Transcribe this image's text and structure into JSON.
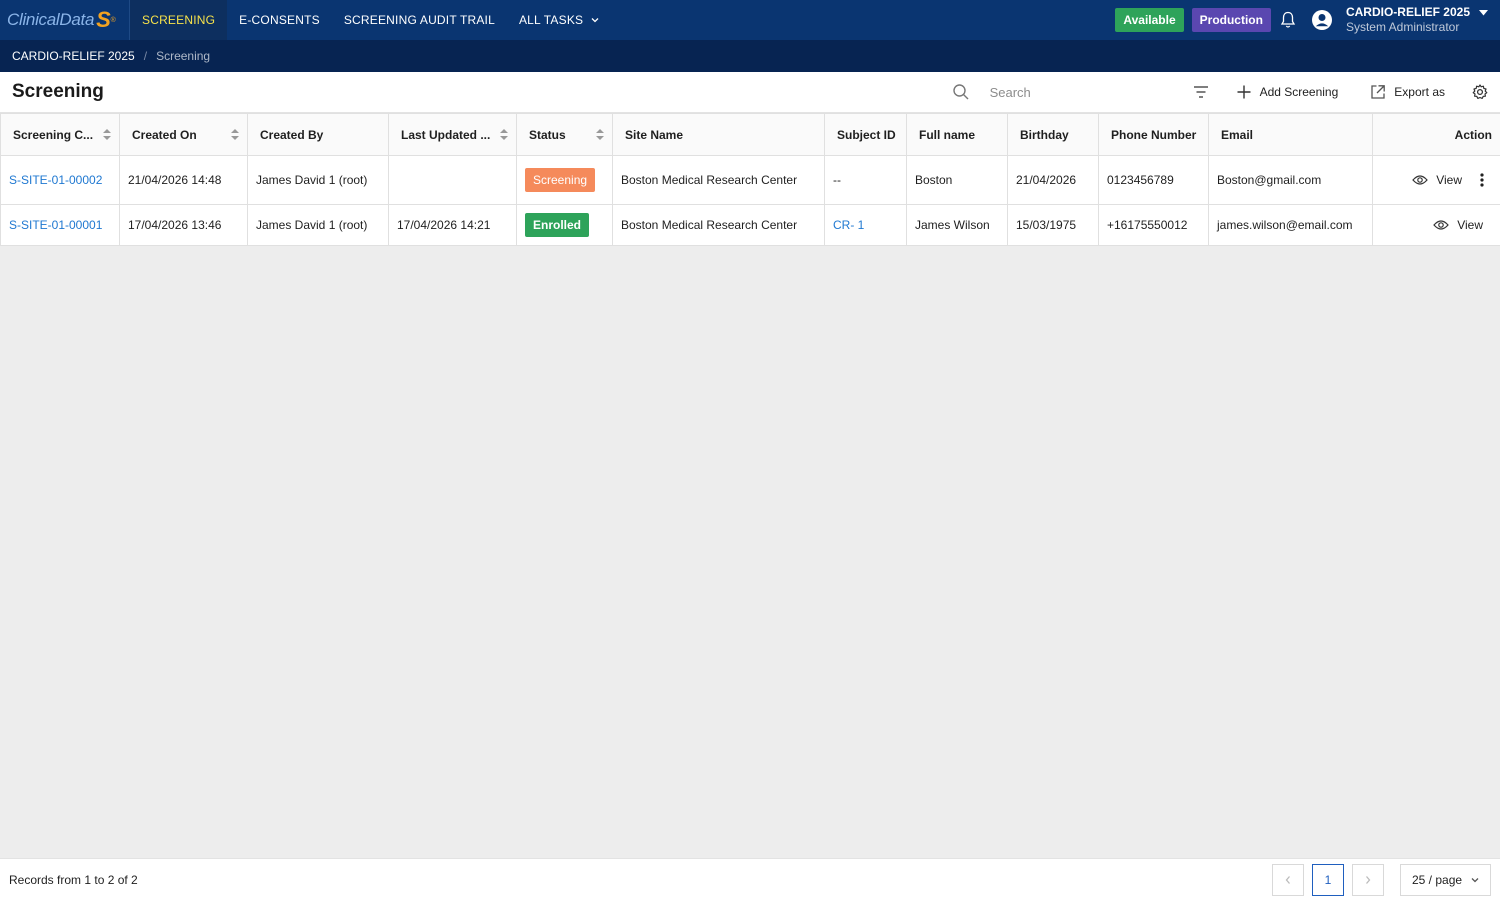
{
  "brand": {
    "logo_text": "ClinicalData",
    "logo_s": "S",
    "logo_reg": "®"
  },
  "nav": {
    "items": [
      {
        "label": "SCREENING",
        "active": true
      },
      {
        "label": "E-CONSENTS",
        "active": false
      },
      {
        "label": "SCREENING AUDIT TRAIL",
        "active": false
      },
      {
        "label": "ALL TASKS",
        "active": false,
        "has_dropdown": true
      }
    ]
  },
  "status_badges": {
    "available": "Available",
    "production": "Production"
  },
  "colors": {
    "nav_bg": "#0a3571",
    "breadcrumb_bg": "#072452",
    "available": "#2ea35a",
    "production": "#5a47b0",
    "screening": "#f58a5b",
    "enrolled": "#2ea35a",
    "link": "#1f78d1"
  },
  "user": {
    "study": "CARDIO-RELIEF 2025",
    "role": "System Administrator"
  },
  "breadcrumb": {
    "root": "CARDIO-RELIEF 2025",
    "separator": "/",
    "current": "Screening"
  },
  "toolbar": {
    "title": "Screening",
    "search_placeholder": "Search",
    "add_label": "Add Screening",
    "export_label": "Export as"
  },
  "table": {
    "columns": [
      "Screening C...",
      "Created On",
      "Created By",
      "Last Updated ...",
      "Status",
      "Site Name",
      "Subject ID",
      "Full name",
      "Birthday",
      "Phone Number",
      "Email",
      "Action"
    ],
    "rows": [
      {
        "code": "S-SITE-01-00002",
        "created_on": "21/04/2026 14:48",
        "created_by": "James David 1 (root)",
        "last_updated": "",
        "status": "Screening",
        "site": "Boston Medical Research Center",
        "subject_id": "--",
        "full_name": "Boston",
        "birthday": "21/04/2026",
        "phone": "0123456789",
        "email": "Boston@gmail.com",
        "action": "View"
      },
      {
        "code": "S-SITE-01-00001",
        "created_on": "17/04/2026 13:46",
        "created_by": "James David 1 (root)",
        "last_updated": "17/04/2026 14:21",
        "status": "Enrolled",
        "site": "Boston Medical Research Center",
        "subject_id": "CR- 1",
        "full_name": "James Wilson",
        "birthday": "15/03/1975",
        "phone": "+16175550012",
        "email": "james.wilson@email.com",
        "action": "View"
      }
    ]
  },
  "footer": {
    "records": "Records from 1 to 2 of 2",
    "current_page": "1",
    "page_size": "25 / page"
  }
}
